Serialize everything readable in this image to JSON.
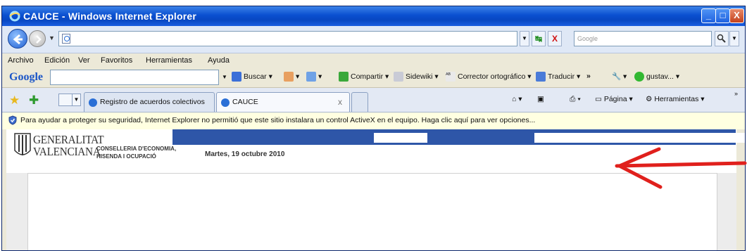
{
  "window": {
    "title": "CAUCE - Windows Internet Explorer",
    "controls": {
      "minimize": "_",
      "maximize": "□",
      "close": "X"
    }
  },
  "address_bar": {
    "url": "",
    "search_placeholder": "Google"
  },
  "menu": [
    "Archivo",
    "Edición",
    "Ver",
    "Favoritos",
    "Herramientas",
    "Ayuda"
  ],
  "google_toolbar": {
    "logo": "Google",
    "items": [
      "Buscar",
      "Compartir",
      "Sidewiki",
      "Corrector ortográfico",
      "Traducir",
      "gustav..."
    ],
    "more": "»"
  },
  "tabs": [
    {
      "label": "Registro de acuerdos colectivos",
      "active": false
    },
    {
      "label": "CAUCE",
      "active": true,
      "close": "x"
    }
  ],
  "command_bar": {
    "page": "Página",
    "tools": "Herramientas"
  },
  "info_bar": {
    "message": "Para ayudar a proteger su seguridad, Internet Explorer no permitió que este sitio instalara un control ActiveX en el equipo. Haga clic aquí para ver opciones..."
  },
  "page": {
    "logo_line1": "GENERALITAT",
    "logo_line2": "VALENCIANA",
    "department_line1": "CONSELLERIA D'ECONOMIA,",
    "department_line2": "HISENDA I OCUPACIÓ",
    "date": "Martes, 19 octubre 2010"
  },
  "colors": {
    "titlebar": "#0a4fd0",
    "infobar": "#ffffe1",
    "page_bar": "#2e56a8",
    "arrow": "#e0201c"
  }
}
